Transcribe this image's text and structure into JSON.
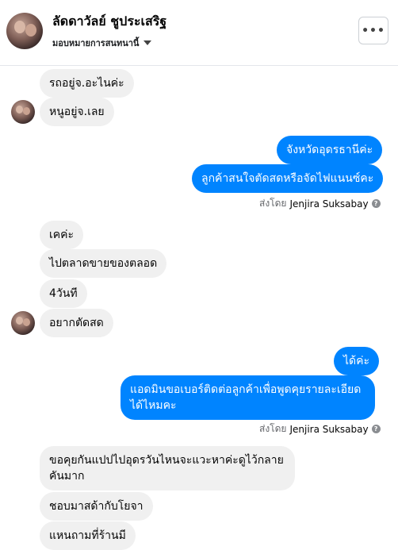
{
  "header": {
    "contact_name": "ลัดดาวัลย์ ชูประเสริฐ",
    "assign_label": "มอบหมายการสนทนานี้",
    "more_label": "•••"
  },
  "messages": [
    {
      "dir": "in",
      "text": "รถอยู่จ.อะไนค่ะ"
    },
    {
      "dir": "in",
      "text": "หนูอยู่จ.เลย"
    },
    {
      "dir": "out",
      "text": "จังหวัดอุดรธานีค่ะ"
    },
    {
      "dir": "out",
      "text": "ลูกค้าสนใจตัดสดหรือจัดไฟแนนซ์คะ"
    },
    {
      "dir": "in",
      "text": "เคค่ะ"
    },
    {
      "dir": "in",
      "text": "ไปตลาดขายของตลอด"
    },
    {
      "dir": "in",
      "text": "4วันที"
    },
    {
      "dir": "in",
      "text": "อยากตัดสด"
    },
    {
      "dir": "out",
      "text": "ได้ค่ะ"
    },
    {
      "dir": "out",
      "text": "แอดมินขอเบอร์ติดต่อลูกค้าเพื่อพูดคุยรายละเอียดได้ไหมคะ"
    },
    {
      "dir": "in",
      "text": "ขอคุยกันแปปไปอุดรวันไหนจะแวะหาค่ะดูไว้กลายคันมาก"
    },
    {
      "dir": "in",
      "text": "ชอบมาสด้ากับโยจา"
    },
    {
      "dir": "in",
      "text": "แหนถามที่ร้านมี"
    }
  ],
  "sent_by": {
    "prefix": "ส่งโดย",
    "name": "Jenjira Suksabay",
    "help_icon": "?"
  }
}
